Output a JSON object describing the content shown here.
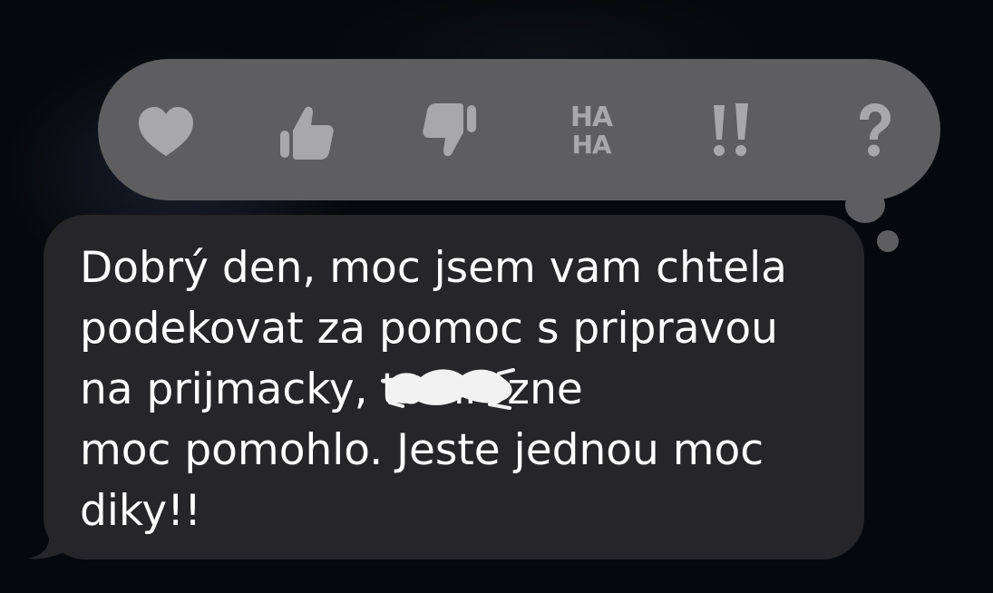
{
  "reactions": [
    {
      "icon": "heart-icon"
    },
    {
      "icon": "thumbs-up-icon"
    },
    {
      "icon": "thumbs-down-icon"
    },
    {
      "icon": "haha-icon",
      "line1": "HA",
      "line2": "HA"
    },
    {
      "icon": "exclamation-icon"
    },
    {
      "icon": "question-icon"
    }
  ],
  "colors": {
    "background": "#06080c",
    "reaction_bar": "#5e5e60",
    "reaction_icon": "#a8a8aa",
    "message_bubble": "#262628",
    "message_text": "#ffffff"
  },
  "message": {
    "lines": [
      "Dobrý den, moc jsem vam chtela",
      "podekovat za pomoc s pripravou",
      "na prijmacky,         to hrozne",
      "moc pomohlo. Jeste jednou moc",
      "diky!!"
    ]
  }
}
